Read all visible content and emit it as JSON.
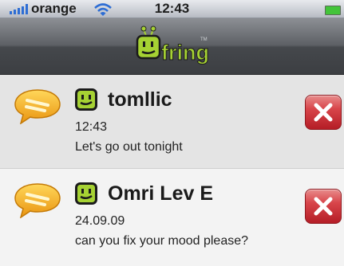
{
  "status_bar": {
    "carrier": "orange",
    "time": "12:43"
  },
  "app": {
    "logo_text": "fring",
    "logo_trademark": "TM"
  },
  "messages": [
    {
      "name": "tomllic",
      "time": "12:43",
      "text": "Let's go out tonight"
    },
    {
      "name": "Omri Lev E",
      "time": "24.09.09",
      "text": "can you fix your mood please?"
    }
  ],
  "colors": {
    "accent_green": "#a6d233",
    "delete_red": "#d8454a",
    "bubble_orange": "#f2a91f"
  },
  "icons": [
    "signal-icon",
    "wifi-icon",
    "battery-icon",
    "chat-bubble-icon",
    "fring-contact-icon",
    "delete-icon"
  ]
}
